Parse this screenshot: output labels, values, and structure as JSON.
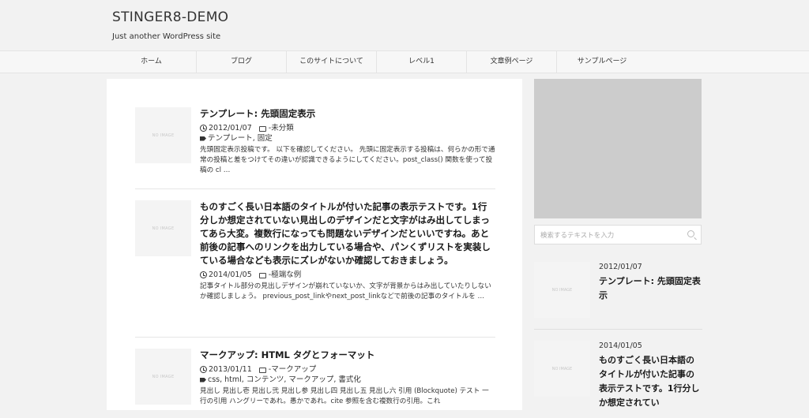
{
  "site": {
    "title": "STINGER8-DEMO",
    "description": "Just another WordPress site"
  },
  "nav": {
    "items": [
      "ホーム",
      "ブログ",
      "このサイトについて",
      "レベル1",
      "文章例ページ",
      "サンプルページ"
    ]
  },
  "thumbnail_placeholder": "NO IMAGE",
  "posts": [
    {
      "title": "テンプレート: 先頭固定表示",
      "date": "2012/01/07",
      "category": "未分類",
      "tags": "テンプレート, 固定",
      "excerpt": "先頭固定表示投稿です。 以下を確認してください。 先頭に固定表示する投稿は、何らかの形で通常の投稿と差をつけてその違いが認識できるようにしてください。post_class() 関数を使って投稿の cl …"
    },
    {
      "title": "ものすごく長い日本語のタイトルが付いた記事の表示テストです。1行分しか想定されていない見出しのデザインだと文字がはみ出してしまってあら大変。複数行になっても問題ないデザインだといいですね。あと前後の記事へのリンクを出力している場合や、パンくずリストを実装している場合なども表示にズレがないか確認しておきましょう。",
      "date": "2014/01/05",
      "category": "極端な例",
      "tags": "",
      "excerpt": "記事タイトル部分の見出しデザインが崩れていないか、文字が背景からはみ出していたりしないか確認しましょう。 previous_post_linkやnext_post_linkなどで前後の記事のタイトルを …"
    },
    {
      "title": "マークアップ: HTML タグとフォーマット",
      "date": "2013/01/11",
      "category": "マークアップ",
      "tags": "css, html, コンテンツ, マークアップ, 書式化",
      "excerpt": "見出し 見出し壱 見出し弐 見出し参 見出し四 見出し五 見出し六 引用 (Blockquote) テスト 一行の引用 ハングリーであれ。愚かであれ。cite 参照を含む複数行の引用。これ"
    }
  ],
  "sidebar": {
    "search_placeholder": "検索するテキストを入力",
    "recent": [
      {
        "date": "2012/01/07",
        "title": "テンプレート: 先頭固定表示"
      },
      {
        "date": "2014/01/05",
        "title": "ものすごく長い日本語のタイトルが付いた記事の表示テストです。1行分しか想定されてい"
      }
    ]
  }
}
